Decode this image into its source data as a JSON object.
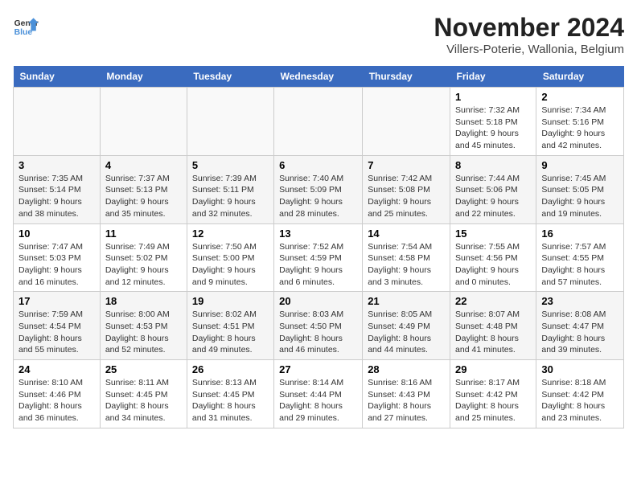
{
  "logo": {
    "text_general": "General",
    "text_blue": "Blue"
  },
  "header": {
    "month": "November 2024",
    "location": "Villers-Poterie, Wallonia, Belgium"
  },
  "weekdays": [
    "Sunday",
    "Monday",
    "Tuesday",
    "Wednesday",
    "Thursday",
    "Friday",
    "Saturday"
  ],
  "weeks": [
    [
      {
        "day": "",
        "info": ""
      },
      {
        "day": "",
        "info": ""
      },
      {
        "day": "",
        "info": ""
      },
      {
        "day": "",
        "info": ""
      },
      {
        "day": "",
        "info": ""
      },
      {
        "day": "1",
        "sunrise": "Sunrise: 7:32 AM",
        "sunset": "Sunset: 5:18 PM",
        "daylight": "Daylight: 9 hours and 45 minutes."
      },
      {
        "day": "2",
        "sunrise": "Sunrise: 7:34 AM",
        "sunset": "Sunset: 5:16 PM",
        "daylight": "Daylight: 9 hours and 42 minutes."
      }
    ],
    [
      {
        "day": "3",
        "sunrise": "Sunrise: 7:35 AM",
        "sunset": "Sunset: 5:14 PM",
        "daylight": "Daylight: 9 hours and 38 minutes."
      },
      {
        "day": "4",
        "sunrise": "Sunrise: 7:37 AM",
        "sunset": "Sunset: 5:13 PM",
        "daylight": "Daylight: 9 hours and 35 minutes."
      },
      {
        "day": "5",
        "sunrise": "Sunrise: 7:39 AM",
        "sunset": "Sunset: 5:11 PM",
        "daylight": "Daylight: 9 hours and 32 minutes."
      },
      {
        "day": "6",
        "sunrise": "Sunrise: 7:40 AM",
        "sunset": "Sunset: 5:09 PM",
        "daylight": "Daylight: 9 hours and 28 minutes."
      },
      {
        "day": "7",
        "sunrise": "Sunrise: 7:42 AM",
        "sunset": "Sunset: 5:08 PM",
        "daylight": "Daylight: 9 hours and 25 minutes."
      },
      {
        "day": "8",
        "sunrise": "Sunrise: 7:44 AM",
        "sunset": "Sunset: 5:06 PM",
        "daylight": "Daylight: 9 hours and 22 minutes."
      },
      {
        "day": "9",
        "sunrise": "Sunrise: 7:45 AM",
        "sunset": "Sunset: 5:05 PM",
        "daylight": "Daylight: 9 hours and 19 minutes."
      }
    ],
    [
      {
        "day": "10",
        "sunrise": "Sunrise: 7:47 AM",
        "sunset": "Sunset: 5:03 PM",
        "daylight": "Daylight: 9 hours and 16 minutes."
      },
      {
        "day": "11",
        "sunrise": "Sunrise: 7:49 AM",
        "sunset": "Sunset: 5:02 PM",
        "daylight": "Daylight: 9 hours and 12 minutes."
      },
      {
        "day": "12",
        "sunrise": "Sunrise: 7:50 AM",
        "sunset": "Sunset: 5:00 PM",
        "daylight": "Daylight: 9 hours and 9 minutes."
      },
      {
        "day": "13",
        "sunrise": "Sunrise: 7:52 AM",
        "sunset": "Sunset: 4:59 PM",
        "daylight": "Daylight: 9 hours and 6 minutes."
      },
      {
        "day": "14",
        "sunrise": "Sunrise: 7:54 AM",
        "sunset": "Sunset: 4:58 PM",
        "daylight": "Daylight: 9 hours and 3 minutes."
      },
      {
        "day": "15",
        "sunrise": "Sunrise: 7:55 AM",
        "sunset": "Sunset: 4:56 PM",
        "daylight": "Daylight: 9 hours and 0 minutes."
      },
      {
        "day": "16",
        "sunrise": "Sunrise: 7:57 AM",
        "sunset": "Sunset: 4:55 PM",
        "daylight": "Daylight: 8 hours and 57 minutes."
      }
    ],
    [
      {
        "day": "17",
        "sunrise": "Sunrise: 7:59 AM",
        "sunset": "Sunset: 4:54 PM",
        "daylight": "Daylight: 8 hours and 55 minutes."
      },
      {
        "day": "18",
        "sunrise": "Sunrise: 8:00 AM",
        "sunset": "Sunset: 4:53 PM",
        "daylight": "Daylight: 8 hours and 52 minutes."
      },
      {
        "day": "19",
        "sunrise": "Sunrise: 8:02 AM",
        "sunset": "Sunset: 4:51 PM",
        "daylight": "Daylight: 8 hours and 49 minutes."
      },
      {
        "day": "20",
        "sunrise": "Sunrise: 8:03 AM",
        "sunset": "Sunset: 4:50 PM",
        "daylight": "Daylight: 8 hours and 46 minutes."
      },
      {
        "day": "21",
        "sunrise": "Sunrise: 8:05 AM",
        "sunset": "Sunset: 4:49 PM",
        "daylight": "Daylight: 8 hours and 44 minutes."
      },
      {
        "day": "22",
        "sunrise": "Sunrise: 8:07 AM",
        "sunset": "Sunset: 4:48 PM",
        "daylight": "Daylight: 8 hours and 41 minutes."
      },
      {
        "day": "23",
        "sunrise": "Sunrise: 8:08 AM",
        "sunset": "Sunset: 4:47 PM",
        "daylight": "Daylight: 8 hours and 39 minutes."
      }
    ],
    [
      {
        "day": "24",
        "sunrise": "Sunrise: 8:10 AM",
        "sunset": "Sunset: 4:46 PM",
        "daylight": "Daylight: 8 hours and 36 minutes."
      },
      {
        "day": "25",
        "sunrise": "Sunrise: 8:11 AM",
        "sunset": "Sunset: 4:45 PM",
        "daylight": "Daylight: 8 hours and 34 minutes."
      },
      {
        "day": "26",
        "sunrise": "Sunrise: 8:13 AM",
        "sunset": "Sunset: 4:45 PM",
        "daylight": "Daylight: 8 hours and 31 minutes."
      },
      {
        "day": "27",
        "sunrise": "Sunrise: 8:14 AM",
        "sunset": "Sunset: 4:44 PM",
        "daylight": "Daylight: 8 hours and 29 minutes."
      },
      {
        "day": "28",
        "sunrise": "Sunrise: 8:16 AM",
        "sunset": "Sunset: 4:43 PM",
        "daylight": "Daylight: 8 hours and 27 minutes."
      },
      {
        "day": "29",
        "sunrise": "Sunrise: 8:17 AM",
        "sunset": "Sunset: 4:42 PM",
        "daylight": "Daylight: 8 hours and 25 minutes."
      },
      {
        "day": "30",
        "sunrise": "Sunrise: 8:18 AM",
        "sunset": "Sunset: 4:42 PM",
        "daylight": "Daylight: 8 hours and 23 minutes."
      }
    ]
  ]
}
